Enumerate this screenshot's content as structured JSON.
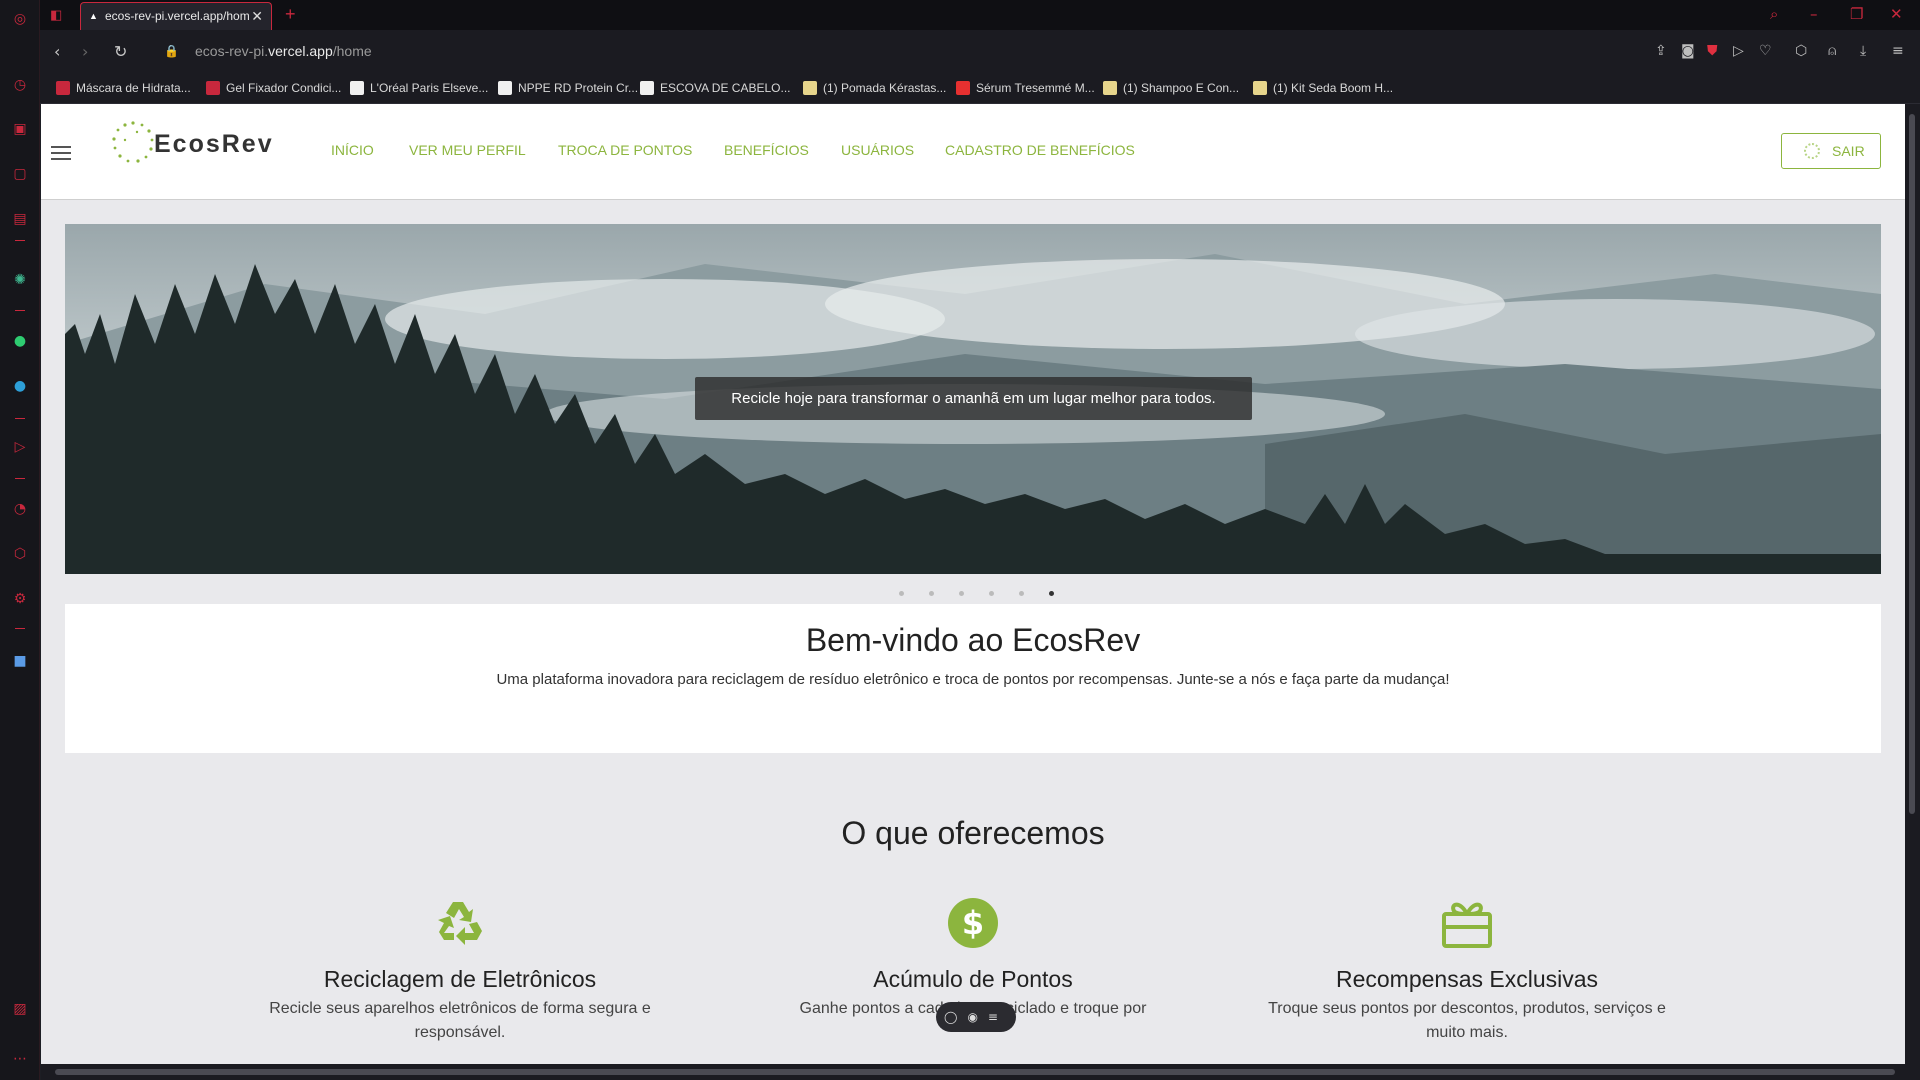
{
  "browser": {
    "tab_title": "ecos-rev-pi.vercel.app/hom",
    "tab_close": "✕",
    "new_tab": "+",
    "url_prefix": "ecos-rev-pi.",
    "url_domain": "vercel.app",
    "url_path": "/home",
    "bookmarks": [
      {
        "label": "Máscara de Hidrata...",
        "color": "#c8283d"
      },
      {
        "label": "Gel Fixador Condici...",
        "color": "#c8283d"
      },
      {
        "label": "L'Oréal Paris Elseve...",
        "color": "#f0f0f0"
      },
      {
        "label": "NPPE RD Protein Cr...",
        "color": "#f0f0f0"
      },
      {
        "label": "ESCOVA DE CABELO...",
        "color": "#f0f0f0"
      },
      {
        "label": "(1) Pomada Kérastas...",
        "color": "#e6d58c"
      },
      {
        "label": "Sérum Tresemmé M...",
        "color": "#e63030"
      },
      {
        "label": "(1) Shampoo E Con...",
        "color": "#e6d58c"
      },
      {
        "label": "(1) Kit Seda Boom H...",
        "color": "#e6d58c"
      }
    ]
  },
  "header": {
    "logo_text": "EcosRev",
    "nav": [
      "INÍCIO",
      "VER MEU PERFIL",
      "TROCA DE PONTOS",
      "BENEFÍCIOS",
      "USUÁRIOS",
      "CADASTRO DE BENEFÍCIOS"
    ],
    "logout_label": "SAIR",
    "accent": "#8cb53e"
  },
  "hero": {
    "caption": "Recicle hoje para transformar o amanhã em um lugar melhor para todos.",
    "slides_count": 6,
    "active_slide": 6
  },
  "welcome": {
    "title": "Bem-vindo ao EcosRev",
    "text": "Uma plataforma inovadora para reciclagem de resíduo eletrônico e troca de pontos por recompensas. Junte-se a nós e faça parte da mudança!"
  },
  "offer": {
    "title": "O que oferecemos",
    "cards": [
      {
        "icon": "recycle-icon",
        "title": "Reciclagem de Eletrônicos",
        "text": "Recicle seus aparelhos eletrônicos de forma segura e responsável."
      },
      {
        "icon": "dollar-icon",
        "title": "Acúmulo de Pontos",
        "text": "Ganhe pontos a cada item reciclado e troque por"
      },
      {
        "icon": "gift-icon",
        "title": "Recompensas Exclusivas",
        "text": "Troque seus pontos por descontos, produtos, serviços e muito mais."
      }
    ]
  }
}
